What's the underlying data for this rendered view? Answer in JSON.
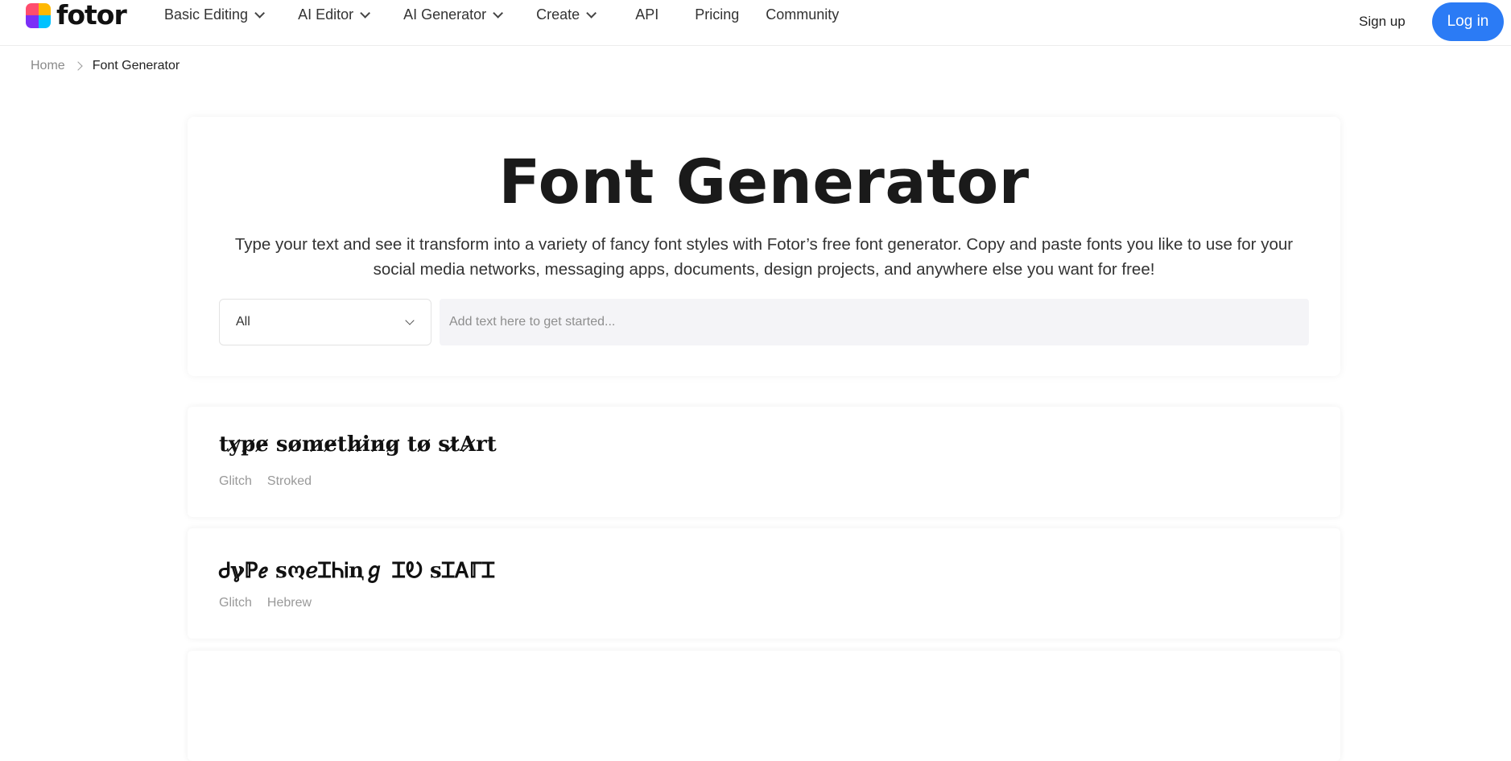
{
  "header": {
    "logo_text": "fotor",
    "logo_colors": [
      "#ff4d6d",
      "#ffb800",
      "#7b2ff7",
      "#00c2ff"
    ],
    "nav": [
      {
        "label": "Basic Editing",
        "dropdown": true
      },
      {
        "label": "AI Editor",
        "dropdown": true
      },
      {
        "label": "AI Generator",
        "dropdown": true
      },
      {
        "label": "Create",
        "dropdown": true
      },
      {
        "label": "API",
        "dropdown": false
      },
      {
        "label": "Pricing",
        "dropdown": false
      },
      {
        "label": "Community",
        "dropdown": false
      }
    ],
    "signup_label": "Sign up",
    "login_label": "Log in",
    "accent_color": "#2b7bf5"
  },
  "breadcrumb": {
    "home": "Home",
    "current": "Font Generator"
  },
  "hero": {
    "title": "Font Generator",
    "description": "Type your text and see it transform into a variety of fancy font styles with Fotor’s free font generator. Copy and paste fonts you like to use for your social media networks, messaging apps, documents, design projects, and anywhere else you want for free!",
    "select_value": "All",
    "input_placeholder": "Add text here to get started..."
  },
  "results": [
    {
      "text": "ty̷p̷e̷ so̷m̷e̷th̷i̷n̷g̷ to̷ st̷A̷rt",
      "tags": [
        "Glitch",
        "Stroked"
      ]
    },
    {
      "text": "Ꮷℽℙℯ ꜱოℯᏆᏂᎥꞑℊ ᏆᎧ ꜱᏆᎪℾᏆ",
      "tags": [
        "Glitch",
        "Hebrew"
      ]
    }
  ]
}
